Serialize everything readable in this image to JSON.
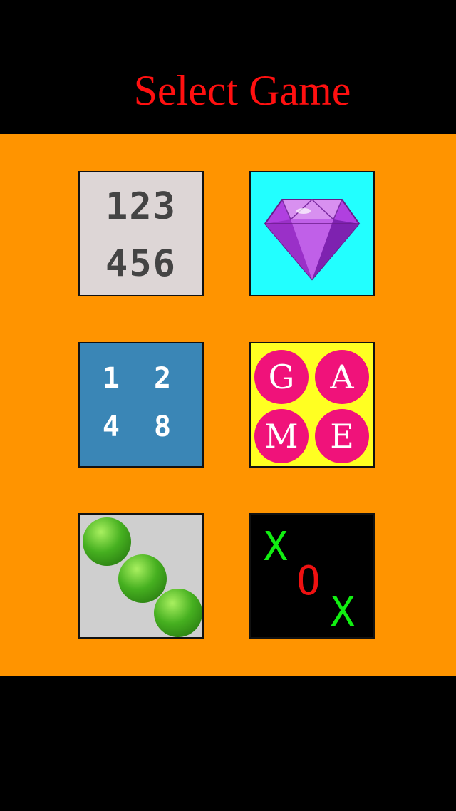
{
  "header": {
    "title": "Select Game"
  },
  "games": [
    {
      "name": "number-slide-puzzle",
      "rows": [
        "123",
        "456"
      ]
    },
    {
      "name": "jewel-match",
      "icon": "gem-icon"
    },
    {
      "name": "2048",
      "rows": [
        "1 2",
        "4 8"
      ]
    },
    {
      "name": "word-game",
      "letters": [
        "G",
        "A",
        "M",
        "E"
      ]
    },
    {
      "name": "ball-game",
      "icon": "green-balls-icon"
    },
    {
      "name": "tic-tac-toe",
      "marks": [
        "X",
        "O",
        "X"
      ]
    }
  ],
  "colors": {
    "title": "#ff1010",
    "panel": "#ff9400",
    "gem": "#b040e0",
    "circle": "#f0127a",
    "x_mark": "#11ee11",
    "o_mark": "#ee1111"
  }
}
